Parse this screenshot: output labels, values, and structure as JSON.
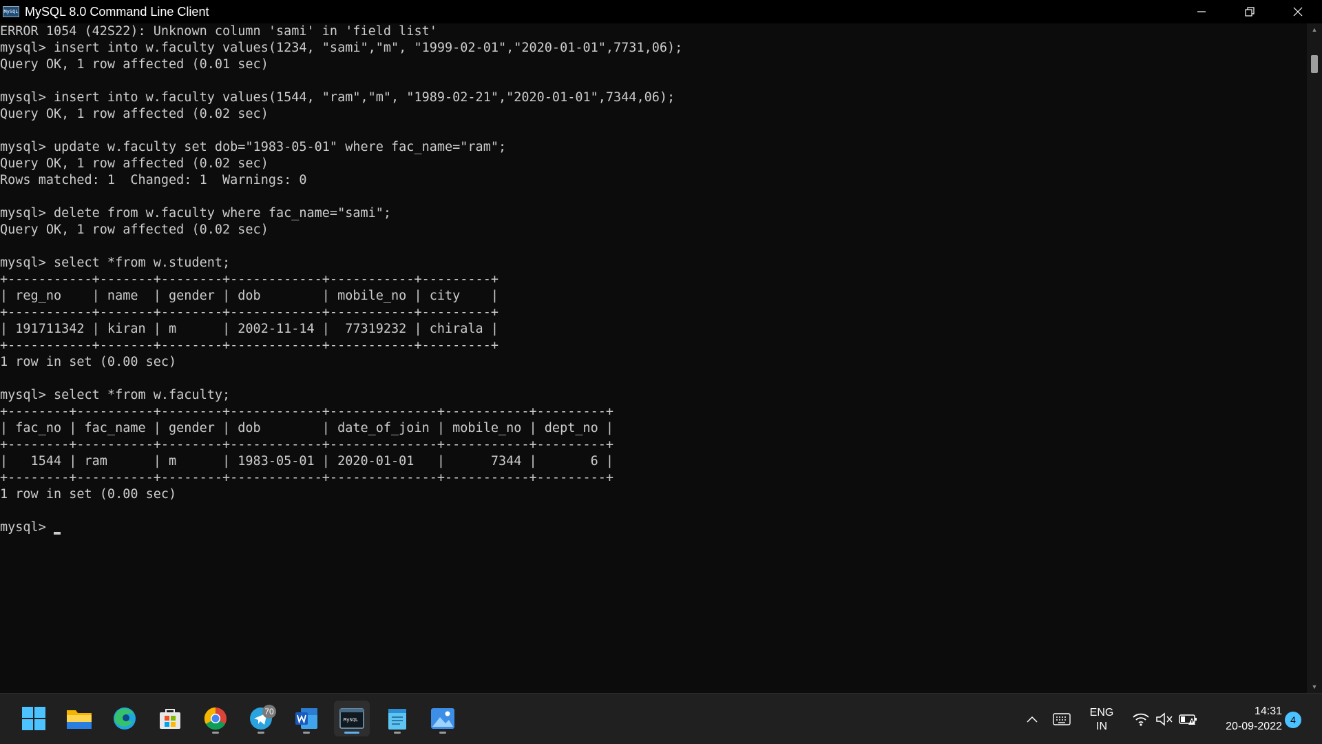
{
  "window": {
    "title": "MySQL 8.0 Command Line Client",
    "icon_label": "MySQL"
  },
  "console": {
    "lines": [
      "ERROR 1054 (42S22): Unknown column 'sami' in 'field list'",
      "mysql> insert into w.faculty values(1234, \"sami\",\"m\", \"1999-02-01\",\"2020-01-01\",7731,06);",
      "Query OK, 1 row affected (0.01 sec)",
      "",
      "mysql> insert into w.faculty values(1544, \"ram\",\"m\", \"1989-02-21\",\"2020-01-01\",7344,06);",
      "Query OK, 1 row affected (0.02 sec)",
      "",
      "mysql> update w.faculty set dob=\"1983-05-01\" where fac_name=\"ram\";",
      "Query OK, 1 row affected (0.02 sec)",
      "Rows matched: 1  Changed: 1  Warnings: 0",
      "",
      "mysql> delete from w.faculty where fac_name=\"sami\";",
      "Query OK, 1 row affected (0.02 sec)",
      "",
      "mysql> select *from w.student;",
      "+-----------+-------+--------+------------+-----------+---------+",
      "| reg_no    | name  | gender | dob        | mobile_no | city    |",
      "+-----------+-------+--------+------------+-----------+---------+",
      "| 191711342 | kiran | m      | 2002-11-14 |  77319232 | chirala |",
      "+-----------+-------+--------+------------+-----------+---------+",
      "1 row in set (0.00 sec)",
      "",
      "mysql> select *from w.faculty;",
      "+--------+----------+--------+------------+--------------+-----------+---------+",
      "| fac_no | fac_name | gender | dob        | date_of_join | mobile_no | dept_no |",
      "+--------+----------+--------+------------+--------------+-----------+---------+",
      "|   1544 | ram      | m      | 1983-05-01 | 2020-01-01   |      7344 |       6 |",
      "+--------+----------+--------+------------+--------------+-----------+---------+",
      "1 row in set (0.00 sec)",
      ""
    ],
    "prompt": "mysql> "
  },
  "taskbar": {
    "apps": [
      {
        "name": "start-button",
        "icon": "windows-logo-icon",
        "active": false,
        "running": false
      },
      {
        "name": "file-explorer-app",
        "icon": "folder-icon",
        "active": false,
        "running": false
      },
      {
        "name": "edge-app",
        "icon": "edge-icon",
        "active": false,
        "running": false
      },
      {
        "name": "store-app",
        "icon": "store-icon",
        "active": false,
        "running": false
      },
      {
        "name": "chrome-app",
        "icon": "chrome-icon",
        "active": false,
        "running": true
      },
      {
        "name": "telegram-app",
        "icon": "telegram-icon",
        "active": false,
        "running": true,
        "badge": "70"
      },
      {
        "name": "word-app",
        "icon": "word-icon",
        "active": false,
        "running": true
      },
      {
        "name": "mysql-client-app",
        "icon": "terminal-icon",
        "active": true,
        "running": true
      },
      {
        "name": "notepad-app",
        "icon": "notepad-icon",
        "active": false,
        "running": true
      },
      {
        "name": "photos-app",
        "icon": "photos-icon",
        "active": false,
        "running": true
      }
    ],
    "tray": {
      "lang_top": "ENG",
      "lang_bottom": "IN",
      "time": "14:31",
      "date": "20-09-2022",
      "notifications": "4"
    }
  },
  "colors": {
    "console_bg": "#0c0c0c",
    "console_fg": "#cccccc",
    "taskbar_bg": "#202020",
    "accent": "#4cc2ff"
  }
}
